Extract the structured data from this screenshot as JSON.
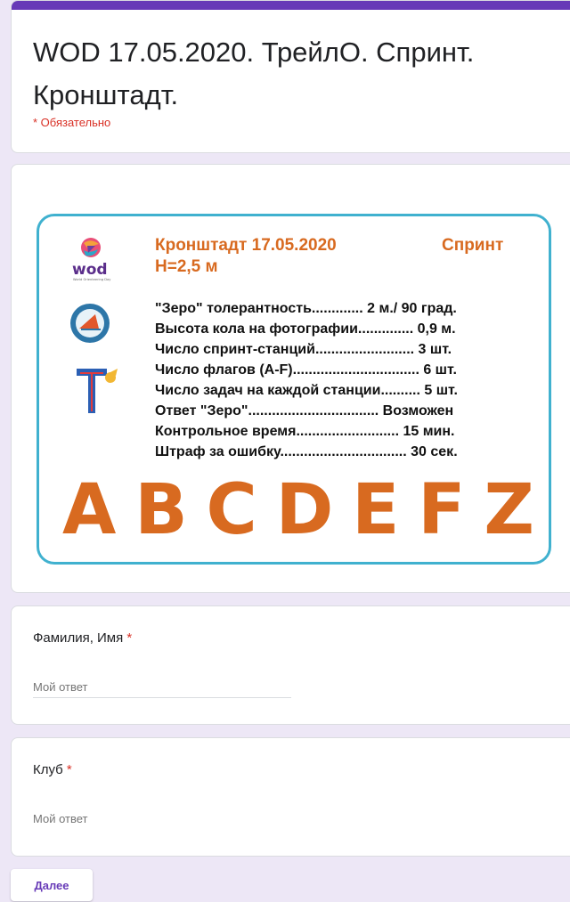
{
  "form": {
    "title": "WOD 17.05.2020. ТрейлО. Спринт. Кронштадт.",
    "required_note": "* Обязательно"
  },
  "poster": {
    "date_line": "Кронштадт 17.05.2020",
    "event_type": "Спринт",
    "height_line": "H=2,5 м",
    "lines": [
      "\"Зеро\" толерантность............. 2 м./ 90 град.",
      "Высота кола на фотографии.............. 0,9 м.",
      "Число спринт-станций......................... 3 шт.",
      "Число флагов (A-F)................................ 6 шт.",
      "Число задач на каждой станции.......... 5 шт.",
      "Ответ \"Зеро\"................................. Возможен",
      "Контрольное время.......................... 15 мин.",
      "Штраф за ошибку................................ 30 сек."
    ],
    "letters": [
      "A",
      "B",
      "C",
      "D",
      "E",
      "F",
      "Z"
    ],
    "logo_text": "wod",
    "logo_subtext": "World Orienteering Day",
    "accent_color": "#d86a20",
    "frame_color": "#40b1cf"
  },
  "questions": [
    {
      "label": "Фамилия, Имя",
      "required_mark": "*",
      "placeholder": "Мой ответ"
    },
    {
      "label": "Клуб",
      "required_mark": "*",
      "placeholder": "Мой ответ"
    }
  ],
  "next_button": "Далее",
  "theme": {
    "primary": "#673ab7",
    "background": "#ede7f6",
    "required": "#d93025"
  }
}
